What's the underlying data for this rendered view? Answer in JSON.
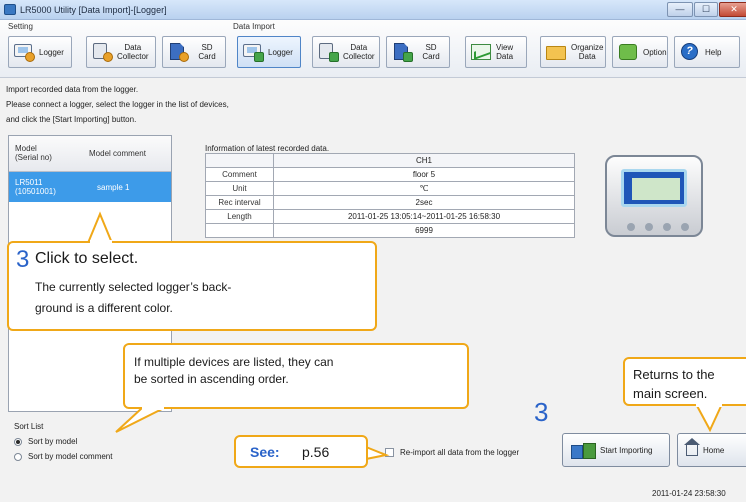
{
  "window": {
    "title": "LR5000 Utility [Data Import]-[Logger]",
    "controls": {
      "minimize": "—",
      "maximize": "☐",
      "close": "✕"
    }
  },
  "toolbar": {
    "setting_group": "Setting",
    "import_group": "Data Import",
    "setting_buttons": [
      {
        "label": "Logger",
        "icon": "logger-icon"
      },
      {
        "label": "Data\nCollector",
        "icon": "data-collector-icon"
      },
      {
        "label": "SD Card",
        "icon": "sd-card-icon"
      }
    ],
    "import_buttons": [
      {
        "label": "Logger",
        "icon": "logger-icon"
      },
      {
        "label": "Data\nCollector",
        "icon": "data-collector-icon"
      },
      {
        "label": "SD Card",
        "icon": "sd-card-icon"
      }
    ],
    "other_buttons": [
      {
        "label": "View\nData",
        "icon": "view-data-icon"
      },
      {
        "label": "Organize\nData",
        "icon": "folder-icon"
      },
      {
        "label": "Option",
        "icon": "option-icon"
      },
      {
        "label": "Help",
        "icon": "help-icon"
      }
    ]
  },
  "instructions": [
    "Import recorded data from the logger.",
    "Please connect a logger, select the logger in the list of devices,",
    "and click the [Start Importing] button."
  ],
  "device_list": {
    "col_model": "Model\n(Serial no)",
    "col_comment": "Model comment",
    "rows": [
      {
        "model": "LR5011\n(10501001)",
        "comment": "sample 1",
        "selected": true
      }
    ]
  },
  "latest_data": {
    "label": "Information of latest recorded data.",
    "channel": "CH1",
    "rows": [
      {
        "key": "Comment",
        "value": "floor 5"
      },
      {
        "key": "Unit",
        "value": "℃"
      },
      {
        "key": "Rec interval",
        "value": "2sec"
      },
      {
        "key": "Length",
        "value": "2011-01-25 13:05:14~2011-01-25 16:58:30"
      },
      {
        "key": "",
        "value": "6999"
      }
    ]
  },
  "sort": {
    "label": "Sort List",
    "options": [
      {
        "label": "Sort by model",
        "selected": true
      },
      {
        "label": "Sort by model comment",
        "selected": false
      }
    ]
  },
  "reimport_label": "Re-import all data from the logger",
  "start_button": "Start Importing",
  "home_button": "Home",
  "timestamp": "2011-01-24 23:58:30",
  "annotations": {
    "select_number": "3",
    "select_title": "Click to select.",
    "select_body": "The currently selected logger’s back-\nground is a different color.",
    "sort_note": "If multiple devices are listed, they can\nbe sorted in ascending order.",
    "see_label": "See:",
    "see_page": "p.56",
    "start_number": "3",
    "home_note": "Returns to the\nmain screen."
  },
  "colors": {
    "accent_orange": "#f0a818",
    "number_blue": "#2a63c9",
    "selected_row": "#3d9be9"
  }
}
